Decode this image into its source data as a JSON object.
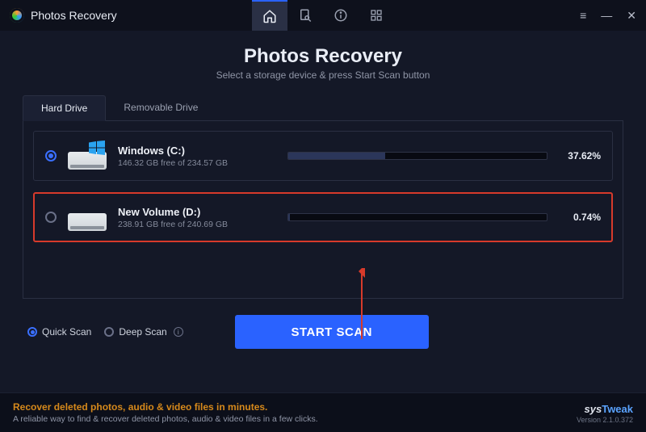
{
  "app": {
    "title": "Photos Recovery"
  },
  "titlebar": {
    "icons": [
      "home",
      "register",
      "info",
      "grid"
    ],
    "window": {
      "menu": "≡",
      "minimize": "—",
      "close": "✕"
    }
  },
  "heading": {
    "title": "Photos Recovery",
    "subtitle": "Select a storage device & press Start Scan button"
  },
  "tabs": [
    {
      "id": "hard-drive",
      "label": "Hard Drive",
      "active": true
    },
    {
      "id": "removable-drive",
      "label": "Removable Drive",
      "active": false
    }
  ],
  "drives": [
    {
      "id": "c",
      "name": "Windows (C:)",
      "free_text": "146.32 GB free of 234.57 GB",
      "used_pct": 37.62,
      "pct_label": "37.62%",
      "selected": true,
      "os_badge": true,
      "highlighted": false
    },
    {
      "id": "d",
      "name": "New Volume (D:)",
      "free_text": "238.91 GB free of 240.69 GB",
      "used_pct": 0.74,
      "pct_label": "0.74%",
      "selected": false,
      "os_badge": false,
      "highlighted": true
    }
  ],
  "scan": {
    "options": [
      {
        "id": "quick",
        "label": "Quick Scan",
        "selected": true
      },
      {
        "id": "deep",
        "label": "Deep Scan",
        "selected": false
      }
    ],
    "button": "START SCAN"
  },
  "footer": {
    "headline": "Recover deleted photos, audio & video files in minutes.",
    "subline": "A reliable way to find & recover deleted photos, audio & video files in a few clicks.",
    "brand_a": "sys",
    "brand_b": "Tweak",
    "version": "Version 2.1.0.372"
  }
}
